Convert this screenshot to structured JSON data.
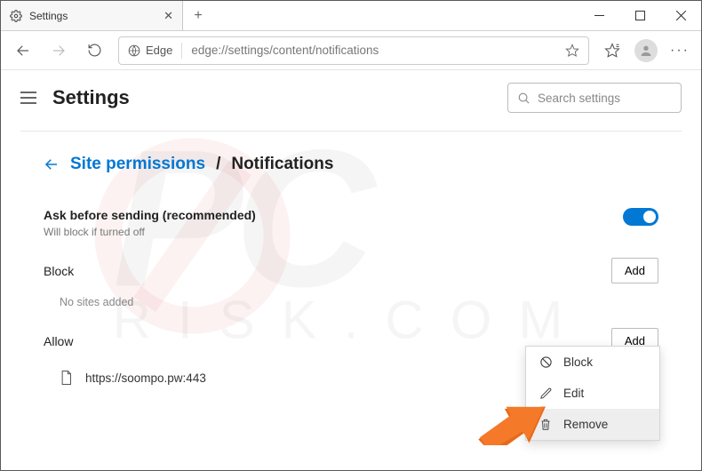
{
  "titlebar": {
    "tab_title": "Settings",
    "close_glyph": "✕",
    "newtab_glyph": "+"
  },
  "addressbar": {
    "browser_label": "Edge",
    "url": "edge://settings/content/notifications"
  },
  "header": {
    "title": "Settings",
    "search_placeholder": "Search settings"
  },
  "breadcrumb": {
    "link": "Site permissions",
    "current": "Notifications"
  },
  "ask": {
    "title": "Ask before sending (recommended)",
    "sub": "Will block if turned off",
    "enabled": true
  },
  "block": {
    "title": "Block",
    "add_label": "Add",
    "empty_text": "No sites added"
  },
  "allow": {
    "title": "Allow",
    "add_label": "Add",
    "sites": [
      {
        "url": "https://soompo.pw:443"
      }
    ]
  },
  "menu": {
    "items": [
      {
        "icon": "block",
        "label": "Block"
      },
      {
        "icon": "edit",
        "label": "Edit"
      },
      {
        "icon": "trash",
        "label": "Remove"
      }
    ],
    "highlighted_index": 2
  }
}
